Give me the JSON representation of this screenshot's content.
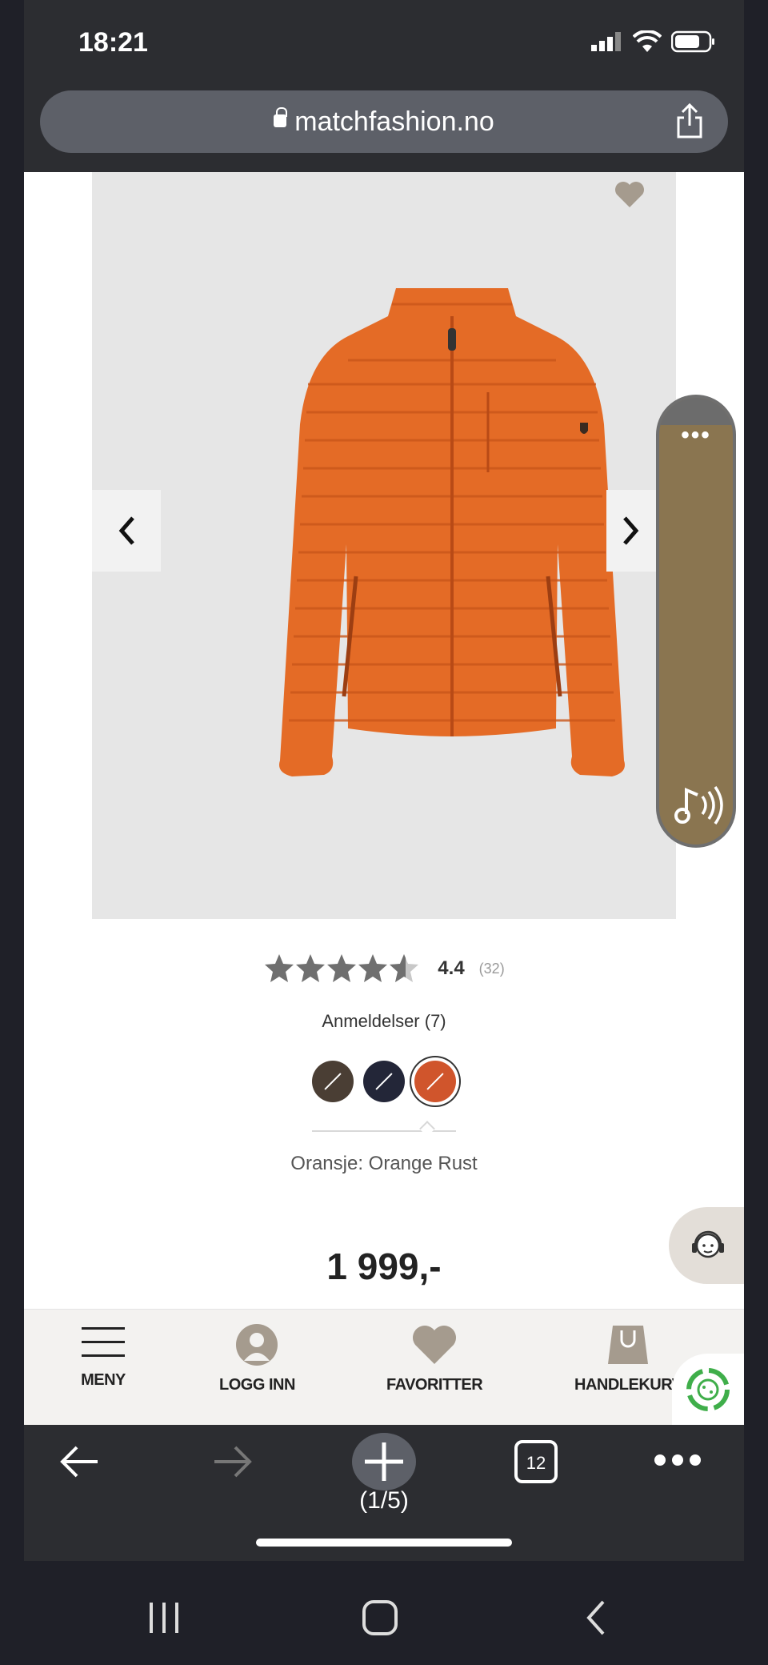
{
  "status_bar": {
    "time": "18:21"
  },
  "browser": {
    "url": "matchfashion.no",
    "tab_count": "12",
    "pager": "(1/5)"
  },
  "product": {
    "rating": "4.4",
    "rating_count": "(32)",
    "reviews_label": "Anmeldelser (7)",
    "color_label": "Oransje: Orange Rust",
    "price": "1 999,-",
    "swatches": [
      {
        "name": "brown",
        "color": "#4a3e34"
      },
      {
        "name": "navy",
        "color": "#232638"
      },
      {
        "name": "orange-rust",
        "color": "#d0552c",
        "selected": true
      }
    ]
  },
  "site_nav": {
    "menu": "MENY",
    "login": "LOGG INN",
    "favorites": "FAVORITTER",
    "cart": "HANDLEKURV"
  },
  "colors": {
    "accent_widget": "#8a7550",
    "jacket": "#e46b26",
    "nav_icon": "#a59b8e"
  }
}
